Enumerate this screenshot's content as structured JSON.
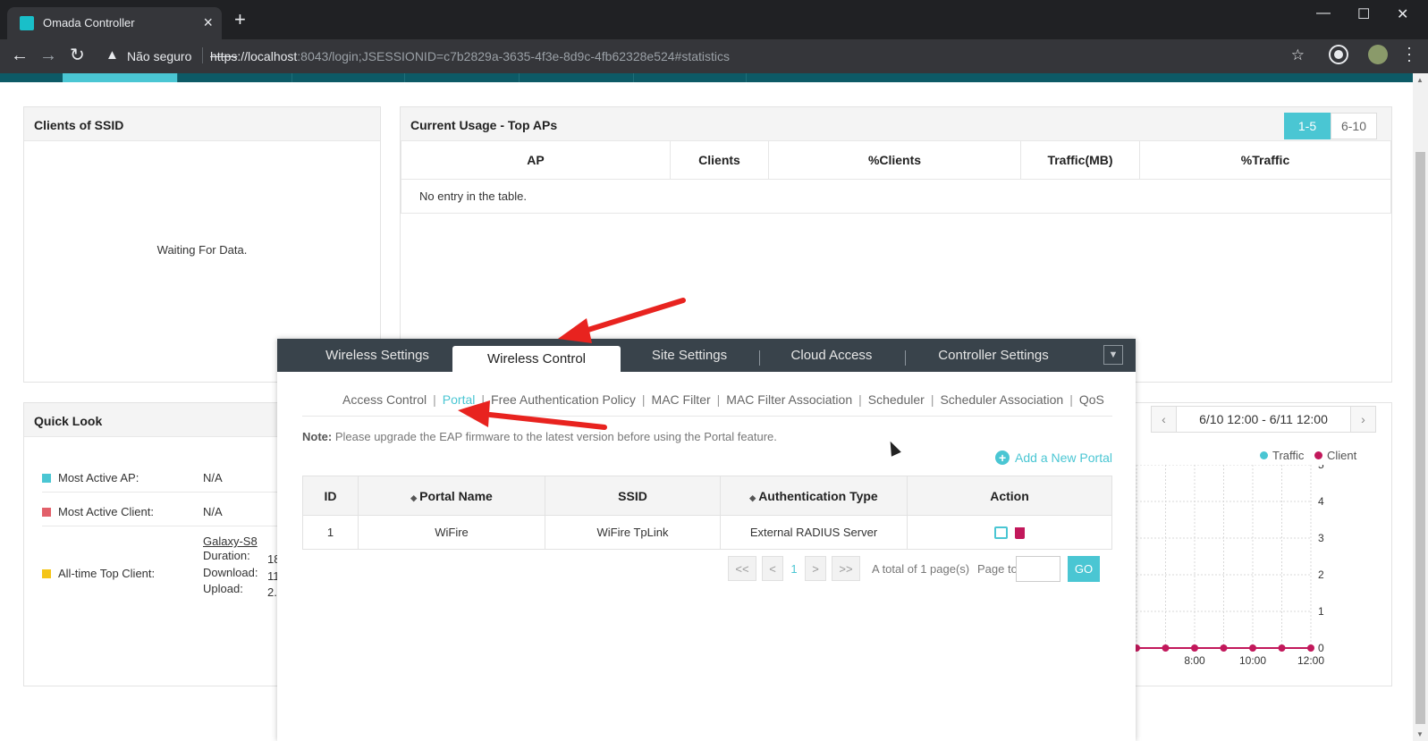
{
  "browser": {
    "tab_title": "Omada Controller",
    "new_tab": "+",
    "security_label": "Não seguro",
    "url_scheme": "https",
    "url_host": "://localhost",
    "url_rest": ":8043/login;JSESSIONID=c7b2829a-3635-4f3e-8d9c-4fb62328e524#statistics"
  },
  "clients_ssid": {
    "title": "Clients of SSID",
    "waiting": "Waiting For Data."
  },
  "top_aps": {
    "title": "Current Usage - Top APs",
    "page_a": "1-5",
    "page_b": "6-10",
    "columns": [
      "AP",
      "Clients",
      "%Clients",
      "Traffic(MB)",
      "%Traffic"
    ],
    "empty": "No entry in the table."
  },
  "quick_look": {
    "title": "Quick Look",
    "rows": [
      {
        "label": "Most Active AP:",
        "value": "N/A",
        "color": "#4ac6d3"
      },
      {
        "label": "Most Active Client:",
        "value": "N/A",
        "color": "#e2606a"
      },
      {
        "label": "All-time Top Client:",
        "value": "",
        "color": "#f5c518"
      }
    ],
    "client_name": "Galaxy-S8",
    "duration_label": "Duration:",
    "download_label": "Download:",
    "upload_label": "Upload:",
    "duration_value": "18",
    "download_value": "11",
    "upload_value": "2."
  },
  "traffic_chart": {
    "range": "6/10 12:00 - 6/11 12:00",
    "legend_traffic": "Traffic",
    "legend_client": "Client",
    "traffic_color": "#4ac6d3",
    "client_color": "#c2185b"
  },
  "chart_data": {
    "type": "line",
    "ylim": [
      0,
      5
    ],
    "y_ticks": [
      "5",
      "4",
      "3",
      "2",
      "1",
      "0"
    ],
    "x_ticks": [
      "8:00",
      "10:00",
      "12:00"
    ],
    "series": [
      {
        "name": "Client",
        "values": [
          0,
          0,
          0,
          0,
          0,
          0,
          0
        ]
      }
    ]
  },
  "modal": {
    "tabs": [
      "Wireless Settings",
      "Wireless Control",
      "Site Settings",
      "Cloud Access",
      "Controller Settings"
    ],
    "active_tab": "Wireless Control",
    "subnav": [
      "Access Control",
      "Portal",
      "Free Authentication Policy",
      "MAC Filter",
      "MAC Filter Association",
      "Scheduler",
      "Scheduler Association",
      "QoS"
    ],
    "active_sub": "Portal",
    "note_label": "Note:",
    "note_text": " Please upgrade the EAP firmware to the latest version before using the Portal feature.",
    "add_portal": "Add a New Portal",
    "columns": [
      "ID",
      "Portal Name",
      "SSID",
      "Authentication Type",
      "Action"
    ],
    "rows": [
      {
        "id": "1",
        "name": "WiFire",
        "ssid": "WiFire TpLink",
        "auth": "External RADIUS Server"
      }
    ],
    "pager": {
      "first": "<<",
      "prev": "<",
      "current": "1",
      "next": ">",
      "last": ">>",
      "total": "A total of 1 page(s)",
      "page_to": "Page to:",
      "go": "GO"
    }
  }
}
